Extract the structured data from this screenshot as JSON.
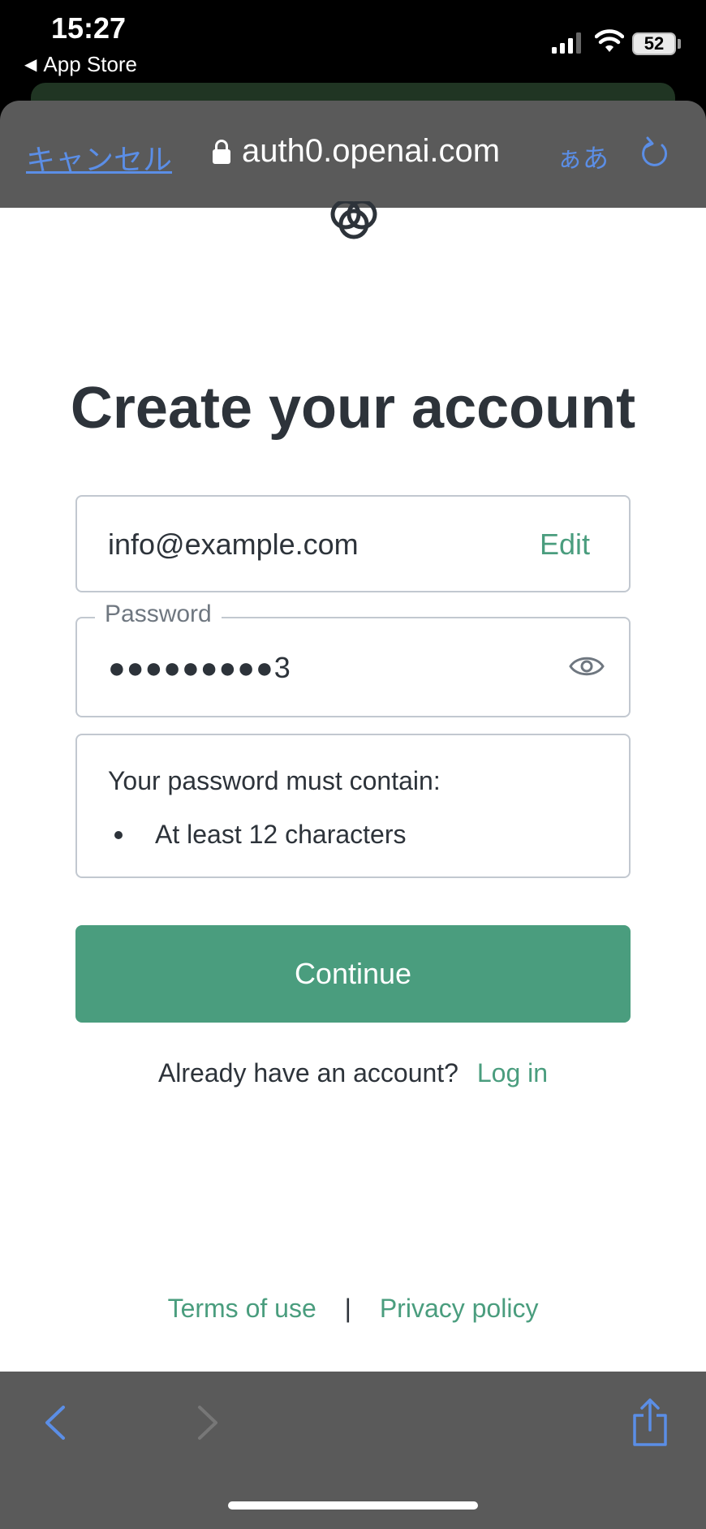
{
  "status_bar": {
    "time": "15:27",
    "back_app": "App Store",
    "battery": "52"
  },
  "browser": {
    "cancel_label": "キャンセル",
    "url": "auth0.openai.com",
    "text_size_label": "ぁあ"
  },
  "page": {
    "heading": "Create your account",
    "email": "info@example.com",
    "edit_label": "Edit",
    "password_label": "Password",
    "password_masked": "●●●●●●●●●3",
    "rules_title": "Your password must contain:",
    "rules": [
      "At least 12 characters"
    ],
    "continue_label": "Continue",
    "already_text": "Already have an account?",
    "login_label": "Log in",
    "terms_label": "Terms of use",
    "separator": "|",
    "privacy_label": "Privacy policy"
  },
  "colors": {
    "brand_green": "#4a9d7e",
    "ios_blue": "#5b8ee6",
    "text_dark": "#2d333a"
  },
  "icons": [
    "lock-icon",
    "reload-icon",
    "eye-icon",
    "back-chevron-icon",
    "forward-chevron-icon",
    "share-icon",
    "openai-logo-icon"
  ]
}
